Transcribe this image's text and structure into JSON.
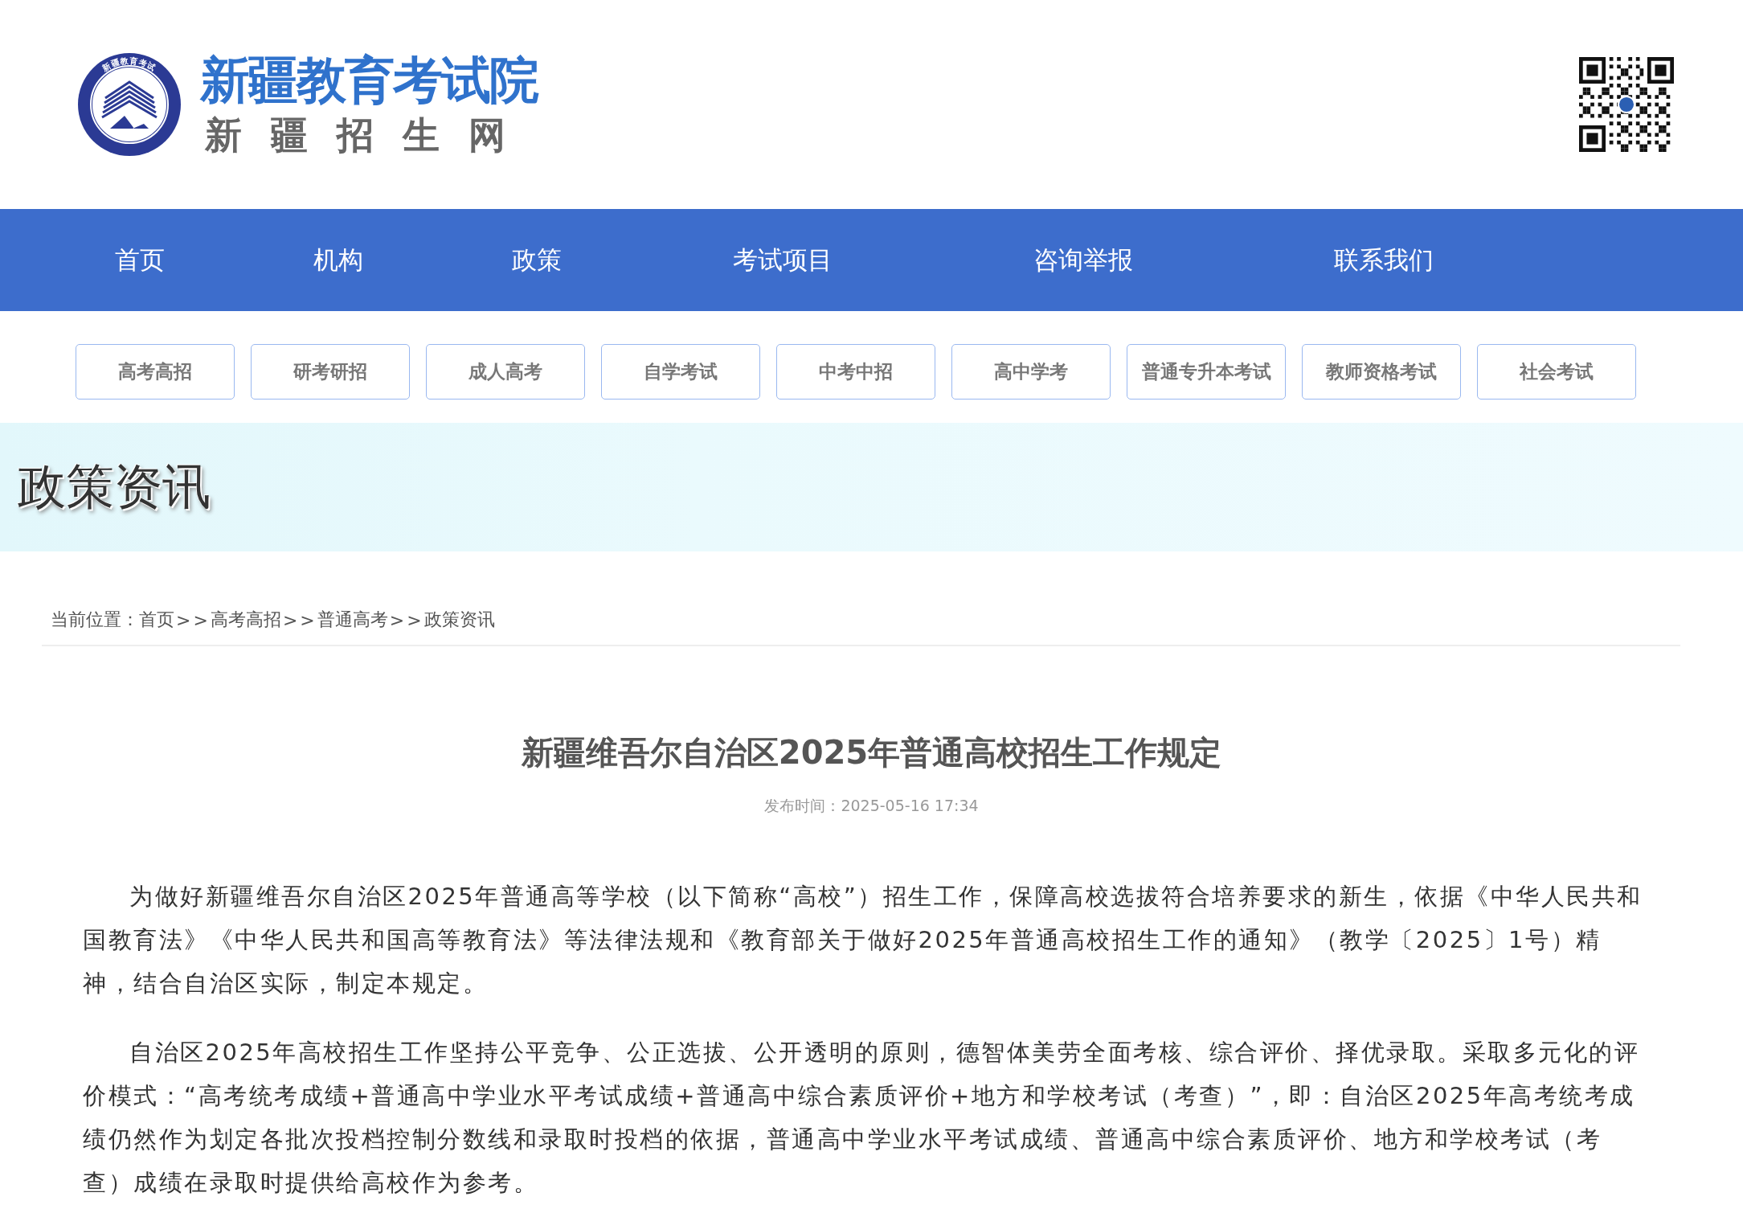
{
  "header": {
    "logo_ring_text": "新疆教育考试",
    "site_name": "新疆教育考试院",
    "site_subtitle": "新疆招生网"
  },
  "nav": [
    {
      "label": "首页"
    },
    {
      "label": "机构"
    },
    {
      "label": "政策"
    },
    {
      "label": "考试项目"
    },
    {
      "label": "咨询举报"
    },
    {
      "label": "联系我们"
    }
  ],
  "categories": [
    "高考高招",
    "研考研招",
    "成人高考",
    "自学考试",
    "中考中招",
    "高中学考",
    "普通专升本考试",
    "教师资格考试",
    "社会考试"
  ],
  "banner": {
    "title": "政策资讯"
  },
  "breadcrumb": {
    "label": "当前位置：",
    "crumbs": [
      {
        "kind": "link",
        "text": "首页"
      },
      {
        "kind": "separator",
        "text": ">>"
      },
      {
        "kind": "link",
        "text": "高考高招"
      },
      {
        "kind": "separator",
        "text": ">>"
      },
      {
        "kind": "link",
        "text": "普通高考"
      },
      {
        "kind": "separator",
        "text": ">>"
      },
      {
        "kind": "link",
        "text": "政策资讯"
      }
    ]
  },
  "article": {
    "title": "新疆维吾尔自治区2025年普通高校招生工作规定",
    "published": "发布时间：2025-05-16 17:34",
    "paragraphs": [
      "为做好新疆维吾尔自治区2025年普通高等学校（以下简称“高校”）招生工作，保障高校选拔符合培养要求的新生，依据《中华人民共和国教育法》《中华人民共和国高等教育法》等法律法规和《教育部关于做好2025年普通高校招生工作的通知》（教学〔2025〕1号）精神，结合自治区实际，制定本规定。",
      "自治区2025年高校招生工作坚持公平竞争、公正选拔、公开透明的原则，德智体美劳全面考核、综合评价、择优录取。采取多元化的评价模式：“高考统考成绩+普通高中学业水平考试成绩+普通高中综合素质评价+地方和学校考试（考查）”，即：自治区2025年高考统考成绩仍然作为划定各批次投档控制分数线和录取时投档的依据，普通高中学业水平考试成绩、普通高中综合素质评价、地方和学校考试（考查）成绩在录取时提供给高校作为参考。"
    ]
  }
}
